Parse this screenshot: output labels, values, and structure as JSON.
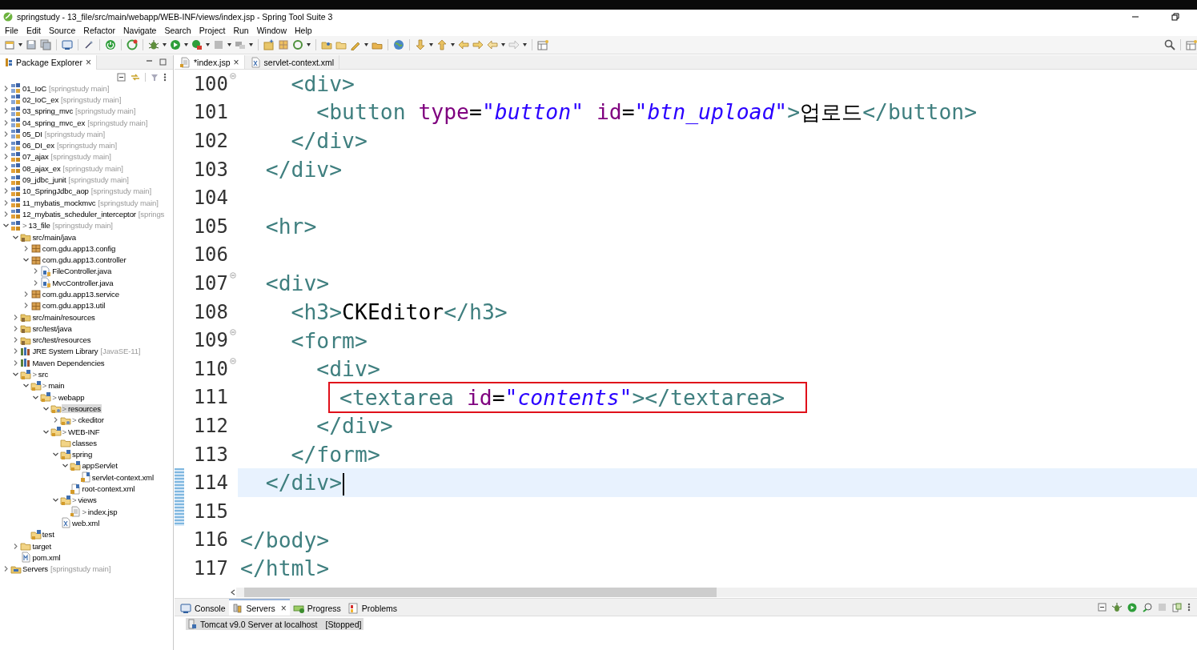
{
  "window": {
    "title": "springstudy - 13_file/src/main/webapp/WEB-INF/views/index.jsp - Spring Tool Suite 3"
  },
  "menu": [
    "File",
    "Edit",
    "Source",
    "Refactor",
    "Navigate",
    "Search",
    "Project",
    "Run",
    "Window",
    "Help"
  ],
  "explorer": {
    "tab": {
      "label": "Package Explorer",
      "close": "×"
    },
    "tree": [
      {
        "label": "01_IoC",
        "decoration": "[springstudy main]",
        "kind": "project-plain",
        "expanded": false,
        "selected": false
      },
      {
        "label": "02_IoC_ex",
        "decoration": "[springstudy main]",
        "kind": "project-plain",
        "expanded": false,
        "selected": false
      },
      {
        "label": "03_spring_mvc",
        "decoration": "[springstudy main]",
        "kind": "project-plain",
        "expanded": false,
        "selected": false
      },
      {
        "label": "04_spring_mvc_ex",
        "decoration": "[springstudy main]",
        "kind": "project-plain",
        "expanded": false,
        "selected": false
      },
      {
        "label": "05_DI",
        "decoration": "[springstudy main]",
        "kind": "project-plain",
        "expanded": false,
        "selected": false
      },
      {
        "label": "06_DI_ex",
        "decoration": "[springstudy main]",
        "kind": "project-plain",
        "expanded": false,
        "selected": false
      },
      {
        "label": "07_ajax",
        "decoration": "[springstudy main]",
        "kind": "project-git",
        "expanded": false,
        "selected": false
      },
      {
        "label": "08_ajax_ex",
        "decoration": "[springstudy main]",
        "kind": "project-git",
        "expanded": false,
        "selected": false
      },
      {
        "label": "09_jdbc_junit",
        "decoration": "[springstudy main]",
        "kind": "project-git",
        "expanded": false,
        "selected": false
      },
      {
        "label": "10_SpringJdbc_aop",
        "decoration": "[springstudy main]",
        "kind": "project-git",
        "expanded": false,
        "selected": false
      },
      {
        "label": "11_mybatis_mockmvc",
        "decoration": "[springstudy main]",
        "kind": "project-git",
        "expanded": false,
        "selected": false
      },
      {
        "label": "12_mybatis_scheduler_interceptor",
        "decoration": "[springs",
        "kind": "project-git",
        "expanded": false,
        "selected": false
      },
      {
        "prefix": ">",
        "label": "13_file",
        "decoration": "[springstudy main]",
        "kind": "project-git",
        "expanded": true,
        "selected": false,
        "children": [
          {
            "label": "src/main/java",
            "kind": "source-folder",
            "expanded": true,
            "selected": false,
            "children": [
              {
                "label": "com.gdu.app13.config",
                "kind": "package",
                "expanded": false,
                "selected": false
              },
              {
                "label": "com.gdu.app13.controller",
                "kind": "package",
                "expanded": true,
                "selected": false,
                "children": [
                  {
                    "label": "FileController.java",
                    "kind": "java-file",
                    "expanded": false,
                    "selected": false
                  },
                  {
                    "label": "MvcController.java",
                    "kind": "java-file",
                    "expanded": false,
                    "selected": false
                  }
                ]
              },
              {
                "label": "com.gdu.app13.service",
                "kind": "package",
                "expanded": false,
                "selected": false
              },
              {
                "label": "com.gdu.app13.util",
                "kind": "package",
                "expanded": false,
                "selected": false
              }
            ]
          },
          {
            "label": "src/main/resources",
            "kind": "source-folder",
            "expanded": false,
            "selected": false
          },
          {
            "label": "src/test/java",
            "kind": "source-folder",
            "expanded": false,
            "selected": false
          },
          {
            "label": "src/test/resources",
            "kind": "source-folder",
            "expanded": false,
            "selected": false
          },
          {
            "label": "JRE System Library",
            "decoration": "[JavaSE-11]",
            "kind": "library",
            "expanded": false,
            "selected": false
          },
          {
            "label": "Maven Dependencies",
            "kind": "library",
            "expanded": false,
            "selected": false
          },
          {
            "prefix": ">",
            "label": "src",
            "kind": "git-folder",
            "expanded": true,
            "selected": false,
            "children": [
              {
                "prefix": ">",
                "label": "main",
                "kind": "git-folder",
                "expanded": true,
                "selected": false,
                "children": [
                  {
                    "prefix": ">",
                    "label": "webapp",
                    "kind": "git-folder",
                    "expanded": true,
                    "selected": false,
                    "children": [
                      {
                        "prefix": ">",
                        "label": "resources",
                        "kind": "untracked-folder",
                        "expanded": true,
                        "selected": true,
                        "children": [
                          {
                            "prefix": ">",
                            "label": "ckeditor",
                            "kind": "untracked-folder",
                            "expanded": false,
                            "selected": false
                          }
                        ]
                      },
                      {
                        "prefix": ">",
                        "label": "WEB-INF",
                        "kind": "git-folder",
                        "expanded": true,
                        "selected": false,
                        "children": [
                          {
                            "label": "classes",
                            "kind": "folder",
                            "selected": false
                          },
                          {
                            "label": "spring",
                            "kind": "git-folder",
                            "expanded": true,
                            "selected": false,
                            "children": [
                              {
                                "label": "appServlet",
                                "kind": "git-folder",
                                "expanded": true,
                                "selected": false,
                                "children": [
                                  {
                                    "label": "servlet-context.xml",
                                    "kind": "spring-file",
                                    "selected": false
                                  }
                                ]
                              },
                              {
                                "label": "root-context.xml",
                                "kind": "spring-file",
                                "selected": false
                              }
                            ]
                          },
                          {
                            "prefix": ">",
                            "label": "views",
                            "kind": "git-folder",
                            "expanded": true,
                            "selected": false,
                            "children": [
                              {
                                "prefix": ">",
                                "label": "index.jsp",
                                "kind": "jsp-file",
                                "selected": false
                              }
                            ]
                          },
                          {
                            "label": "web.xml",
                            "kind": "xml-file",
                            "selected": false
                          }
                        ]
                      }
                    ]
                  }
                ]
              },
              {
                "label": "test",
                "kind": "git-folder",
                "selected": false
              }
            ]
          },
          {
            "label": "target",
            "kind": "folder",
            "expanded": false,
            "selected": false
          },
          {
            "label": "pom.xml",
            "kind": "maven-file",
            "selected": false
          }
        ]
      },
      {
        "label": "Servers",
        "decoration": "[springstudy main]",
        "kind": "servers-project",
        "expanded": false,
        "selected": false
      }
    ]
  },
  "editor": {
    "tabs": [
      {
        "label": "*index.jsp",
        "kind": "jsp-file",
        "selected": true,
        "close": "×"
      },
      {
        "label": "servlet-context.xml",
        "kind": "xml-file",
        "selected": false
      }
    ],
    "lines": [
      {
        "number": "100",
        "fold": true,
        "current": false,
        "changed": false,
        "tokens": [
          {
            "kind": "tag",
            "text": "    <div>"
          }
        ]
      },
      {
        "number": "101",
        "fold": false,
        "current": false,
        "changed": false,
        "tokens": [
          {
            "kind": "tag",
            "text": "      <button"
          },
          {
            "kind": "attr",
            "text": " type"
          },
          {
            "kind": "punct",
            "text": "="
          },
          {
            "kind": "value",
            "text": "\"button\""
          },
          {
            "kind": "attr",
            "text": " id"
          },
          {
            "kind": "punct",
            "text": "="
          },
          {
            "kind": "value",
            "text": "\"btn_upload\""
          },
          {
            "kind": "tag",
            "text": ">"
          },
          {
            "kind": "text",
            "text": "업로드"
          },
          {
            "kind": "tag",
            "text": "</button>"
          }
        ]
      },
      {
        "number": "102",
        "fold": false,
        "current": false,
        "changed": false,
        "tokens": [
          {
            "kind": "tag",
            "text": "    </div>"
          }
        ]
      },
      {
        "number": "103",
        "fold": false,
        "current": false,
        "changed": false,
        "tokens": [
          {
            "kind": "tag",
            "text": "  </div>"
          }
        ]
      },
      {
        "number": "104",
        "fold": false,
        "current": false,
        "changed": false
      },
      {
        "number": "105",
        "fold": false,
        "current": false,
        "changed": false,
        "tokens": [
          {
            "kind": "tag",
            "text": "  <hr>"
          }
        ]
      },
      {
        "number": "106",
        "fold": false,
        "current": false,
        "changed": false
      },
      {
        "number": "107",
        "fold": true,
        "current": false,
        "changed": false,
        "tokens": [
          {
            "kind": "tag",
            "text": "  <div>"
          }
        ]
      },
      {
        "number": "108",
        "fold": false,
        "current": false,
        "changed": false,
        "tokens": [
          {
            "kind": "tag",
            "text": "    <h3>"
          },
          {
            "kind": "text",
            "text": "CKEditor"
          },
          {
            "kind": "tag",
            "text": "</h3>"
          }
        ]
      },
      {
        "number": "109",
        "fold": true,
        "current": false,
        "changed": false,
        "tokens": [
          {
            "kind": "tag",
            "text": "    <form>"
          }
        ]
      },
      {
        "number": "110",
        "fold": true,
        "current": false,
        "changed": false,
        "tokens": [
          {
            "kind": "tag",
            "text": "      <div>"
          }
        ]
      },
      {
        "number": "111",
        "fold": false,
        "current": false,
        "changed": false,
        "annotated": true,
        "tokens": [
          {
            "kind": "tag",
            "text": "<textarea"
          },
          {
            "kind": "attr",
            "text": " id"
          },
          {
            "kind": "punct",
            "text": "="
          },
          {
            "kind": "value",
            "text": "\"contents\""
          },
          {
            "kind": "tag",
            "text": "></textarea>"
          }
        ]
      },
      {
        "number": "112",
        "fold": false,
        "current": false,
        "changed": false,
        "tokens": [
          {
            "kind": "tag",
            "text": "      </div>"
          }
        ]
      },
      {
        "number": "113",
        "fold": false,
        "current": false,
        "changed": false,
        "tokens": [
          {
            "kind": "tag",
            "text": "    </form>"
          }
        ]
      },
      {
        "number": "114",
        "fold": false,
        "current": true,
        "changed": true,
        "cursor": true,
        "tokens": [
          {
            "kind": "tag",
            "text": "  </div>"
          }
        ]
      },
      {
        "number": "115",
        "fold": false,
        "current": false,
        "changed": true
      },
      {
        "number": "116",
        "fold": false,
        "current": false,
        "changed": false,
        "tokens": [
          {
            "kind": "tag",
            "text": "</body>"
          }
        ]
      },
      {
        "number": "117",
        "fold": false,
        "current": false,
        "changed": false,
        "tokens": [
          {
            "kind": "tag",
            "text": "</html>"
          }
        ]
      }
    ]
  },
  "bottom_panel": {
    "tabs": [
      {
        "label": "Console",
        "kind": "console",
        "selected": false
      },
      {
        "label": "Servers",
        "kind": "servers",
        "selected": true,
        "close": "×"
      },
      {
        "label": "Progress",
        "kind": "progress",
        "selected": false
      },
      {
        "label": "Problems",
        "kind": "problems",
        "selected": false
      }
    ],
    "servers": [
      {
        "name": "Tomcat v9.0 Server at localhost",
        "state": "[Stopped]",
        "selected": true
      }
    ]
  }
}
